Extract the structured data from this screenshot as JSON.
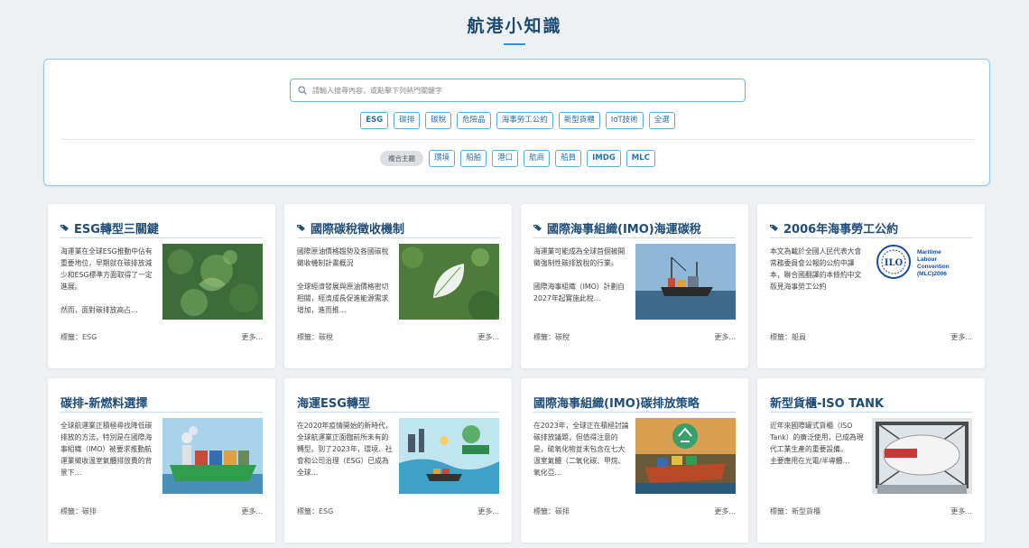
{
  "page": {
    "title": "航港小知識"
  },
  "search": {
    "placeholder": "請輸入搜尋內容，或點擊下列熱門關鍵字"
  },
  "keywords": [
    "ESG",
    "碳排",
    "碳稅",
    "危險品",
    "海事勞工公約",
    "新型貨櫃",
    "IoT技術",
    "全選"
  ],
  "topics": {
    "label": "複合主題",
    "items": [
      "環境",
      "船舶",
      "港口",
      "航商",
      "船員",
      "IMDG",
      "MLC"
    ]
  },
  "cards": [
    {
      "title": "ESG轉型三關鍵",
      "text": "海運業在全球ESG推動中佔有重要地位，早期就在碳排放減少和ESG標準方面取得了一定進展。\n\n然而，面對碳排放高占…",
      "tag": "標籤：ESG",
      "more": "更多...",
      "image": "aerial-forest"
    },
    {
      "title": "國際碳稅徵收機制",
      "text": "國際原油價格趨勢及各國碳稅徵收機制計畫概況\n\n全球經濟發展與原油價格密切相關，經濟成長促進能源需求增加，進而推…",
      "tag": "標籤：碳稅",
      "more": "更多...",
      "image": "co2-leaf"
    },
    {
      "title": "國際海事組織(IMO)海運碳稅",
      "text": "海運業可能成為全球首個被開徵強制性碳排放稅的行業。\n\n國際海事組織（IMO）計劃自2027年起實施此稅…",
      "tag": "標籤：碳稅",
      "more": "更多...",
      "image": "cargo-ship"
    },
    {
      "title": "2006年海事勞工公約",
      "text": "本文為載於全國人民代表大會常務委員會公報的公約中譯本，聯合國翻譯的本條約中文版見海事勞工公約",
      "tag": "標籤：船員",
      "more": "更多...",
      "image": "ilo-logo",
      "logo_text": [
        "Maritime",
        "Labour",
        "Convention",
        "(MLC)2006"
      ]
    },
    {
      "title": "碳排-新燃料選擇",
      "text": "全球航運業正積極尋找降低碳排放的方法，特別是在國際海事組織（IMO）被要求推動航運業徵收溫室氣體排放費的背景下…",
      "tag": "標籤：碳排",
      "more": "更多...",
      "image": "green-ship"
    },
    {
      "title": "海運ESG轉型",
      "text": "在2020年疫情開始的新時代，全球航運業正面臨前所未有的轉型。到了2023年，環境、社會和公司治理（ESG）已成為全球…",
      "tag": "標籤：ESG",
      "more": "更多...",
      "image": "port-illustration"
    },
    {
      "title": "國際海事組織(IMO)碳排放策略",
      "text": "在2023年，全球正在積極討論碳排放議題，但值得注意的是，硫氧化物並未包含在七大溫室氣體（二氧化碳、甲烷、氧化亞…",
      "tag": "標籤：碳排",
      "more": "更多...",
      "image": "recycle-ship"
    },
    {
      "title": "新型貨櫃-ISO TANK",
      "text": "近年來國際罐式貨櫃（ISO Tank）的廣泛使用，已成為現代工業生產的重要設備。\n主要應用在光電/半導體…",
      "tag": "標籤：新型貨櫃",
      "more": "更多...",
      "image": "iso-tank"
    }
  ]
}
